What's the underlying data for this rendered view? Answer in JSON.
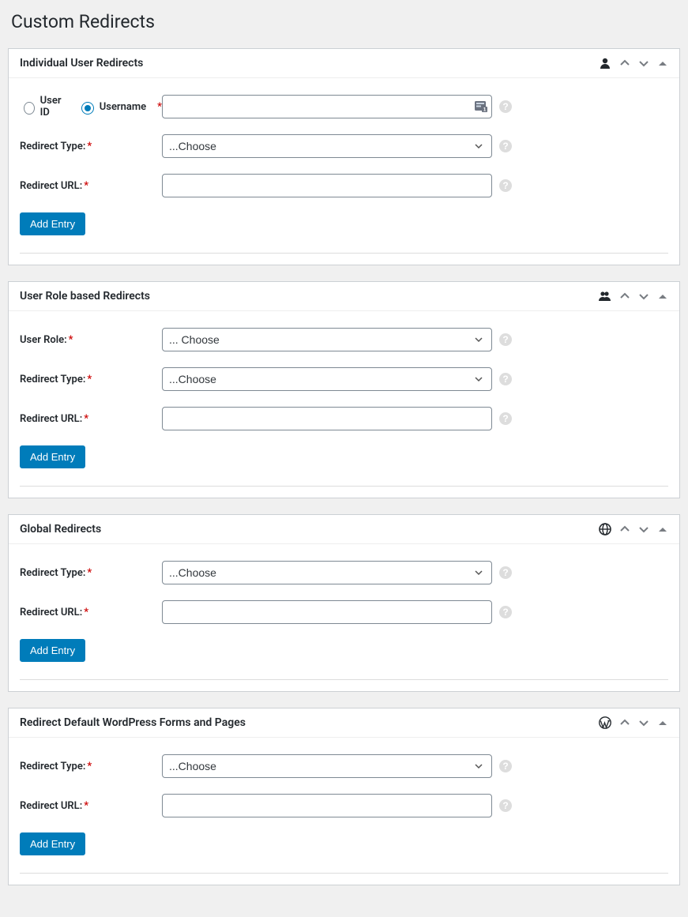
{
  "page_title": "Custom Redirects",
  "labels": {
    "redirect_type": "Redirect Type:",
    "redirect_url": "Redirect URL:",
    "user_role": "User Role:",
    "user_id": "User ID",
    "username": "Username",
    "add_entry": "Add Entry"
  },
  "select_placeholder_choose": "...Choose",
  "select_placeholder_choose_spaced": "... Choose",
  "panels": {
    "individual": {
      "title": "Individual User Redirects"
    },
    "role": {
      "title": "User Role based Redirects"
    },
    "global": {
      "title": "Global Redirects"
    },
    "wp": {
      "title": "Redirect Default WordPress Forms and Pages"
    }
  }
}
